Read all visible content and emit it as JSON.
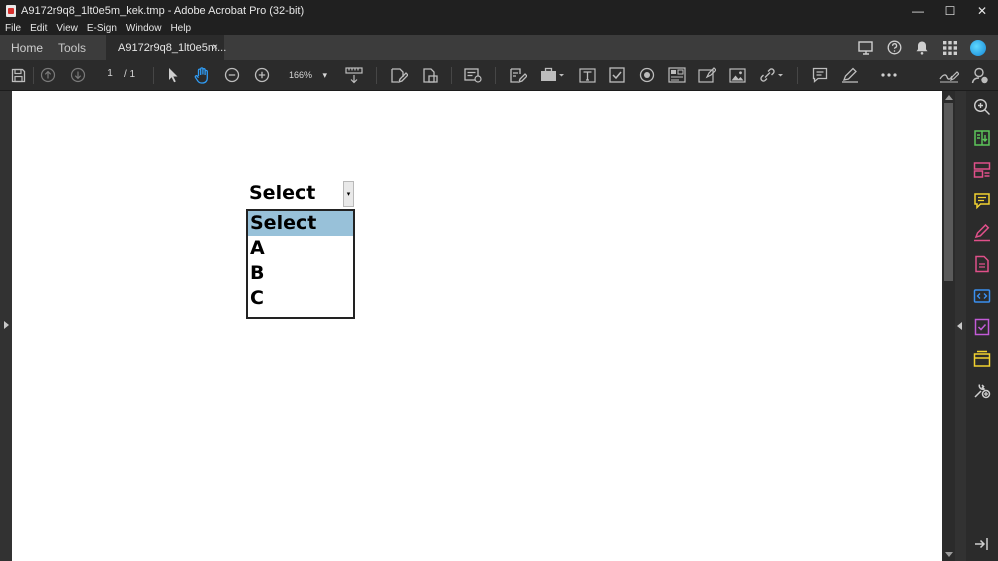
{
  "window": {
    "title": "A9172r9q8_1lt0e5m_kek.tmp - Adobe Acrobat Pro (32-bit)",
    "minimize": "—",
    "maximize": "☐",
    "close": "✕"
  },
  "menu": [
    "File",
    "Edit",
    "View",
    "E-Sign",
    "Window",
    "Help"
  ],
  "tabs": {
    "home": "Home",
    "tools": "Tools",
    "document": "A9172r9q8_1lt0e5m...",
    "close": "×"
  },
  "toolbar": {
    "page_current": "1",
    "page_total": "/ 1",
    "zoom": "166%",
    "zoom_caret": "▾"
  },
  "form": {
    "combo_value": "Select",
    "combo_button": "▾",
    "options": [
      "Select",
      "A",
      "B",
      "C"
    ],
    "selected_index": 0
  },
  "colors": {
    "accent": "#2f9cf5",
    "selection": "#98c1d9",
    "green_tool": "#5cc65a",
    "pink_tool": "#e0508a",
    "yellow_tool": "#f2d230",
    "purple_tool": "#c25bd6",
    "blue_tool": "#3a8ff0"
  },
  "icons": {
    "right_pane": [
      "search-zoom-icon",
      "export-pdf-icon",
      "organize-pages-icon",
      "comment-icon",
      "fill-sign-icon",
      "create-pdf-icon",
      "edit-pdf-icon",
      "prepare-form-icon",
      "review-icon",
      "tools-icon",
      "expand-pane-icon"
    ]
  }
}
